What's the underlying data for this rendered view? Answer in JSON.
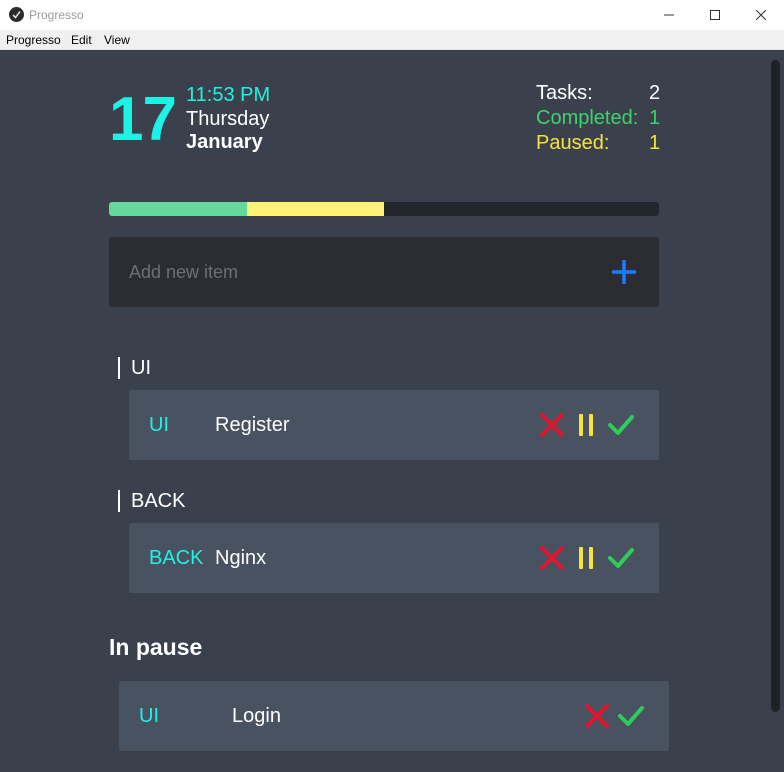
{
  "window": {
    "title": "Progresso",
    "menu": [
      "Progresso",
      "Edit",
      "View"
    ]
  },
  "header": {
    "day": "17",
    "time": "11:53 PM",
    "weekday": "Thursday",
    "month": "January"
  },
  "stats": {
    "tasks_label": "Tasks:",
    "tasks_value": "2",
    "completed_label": "Completed:",
    "completed_value": "1",
    "paused_label": "Paused:",
    "paused_value": "1"
  },
  "progress": {
    "completed_fraction": 0.25,
    "paused_fraction": 0.25,
    "completed_color": "#66d99a",
    "paused_color": "#fff27a",
    "track_color": "#23262d"
  },
  "add_item": {
    "placeholder": "Add new item",
    "button_icon": "plus-icon"
  },
  "groups": [
    {
      "name": "UI",
      "items": [
        {
          "tag": "UI",
          "title": "Register",
          "actions": [
            "delete",
            "pause",
            "complete"
          ]
        }
      ]
    },
    {
      "name": "BACK",
      "items": [
        {
          "tag": "BACK",
          "title": "Nginx",
          "actions": [
            "delete",
            "pause",
            "complete"
          ]
        }
      ]
    }
  ],
  "paused_section": {
    "heading": "In pause",
    "items": [
      {
        "tag": "UI",
        "title": "Login",
        "actions": [
          "delete",
          "complete"
        ]
      }
    ]
  },
  "colors": {
    "accent": "#1ef2e4",
    "completed": "#3ed36a",
    "paused": "#f6e33c",
    "delete": "#e0152f",
    "background": "#3b414c",
    "card": "#485260"
  }
}
